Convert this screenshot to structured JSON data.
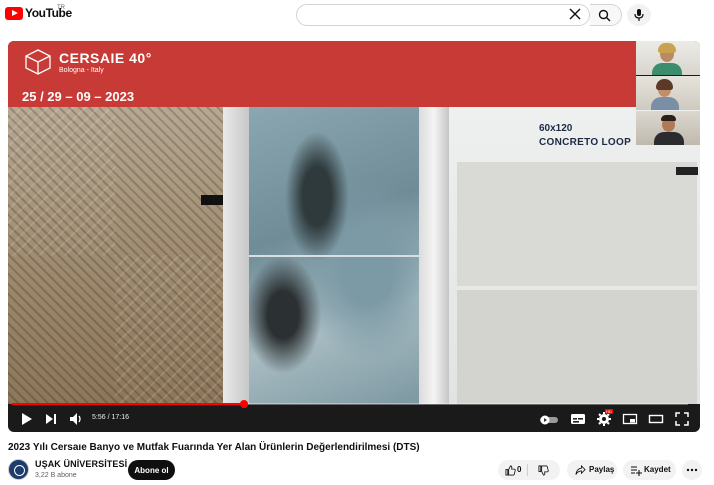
{
  "header": {
    "logo_text": "YouTube",
    "logo_region": "TR",
    "search_placeholder": "",
    "search_value": ""
  },
  "video": {
    "banner": {
      "brand": "CERSAIE 40°",
      "location": "Bologna - Italy",
      "dates": "25 / 29 – 09 – 2023"
    },
    "product_size": "60x120",
    "product_name": "CONCRETO LOOP",
    "current_time": "5:56",
    "duration": "17:16",
    "time_display": "5:56 / 17:16",
    "progress_fraction": 0.343,
    "title": "2023 Yılı Cersaıe Banyo ve Mutfak Fuarında Yer Alan Ürünlerin Değerlendirilmesi (DTS)"
  },
  "channel": {
    "name": "UŞAK ÜNİVERSİTESİ",
    "subscribers": "3,22 B abone",
    "subscribe_label": "Abone ol"
  },
  "actions": {
    "like_count": "0",
    "share_label": "Paylaş",
    "save_label": "Kaydet"
  },
  "colors": {
    "brand_red": "#ff0000",
    "banner_red": "#c83a35",
    "subscribe_bg": "#0f0f0f"
  }
}
